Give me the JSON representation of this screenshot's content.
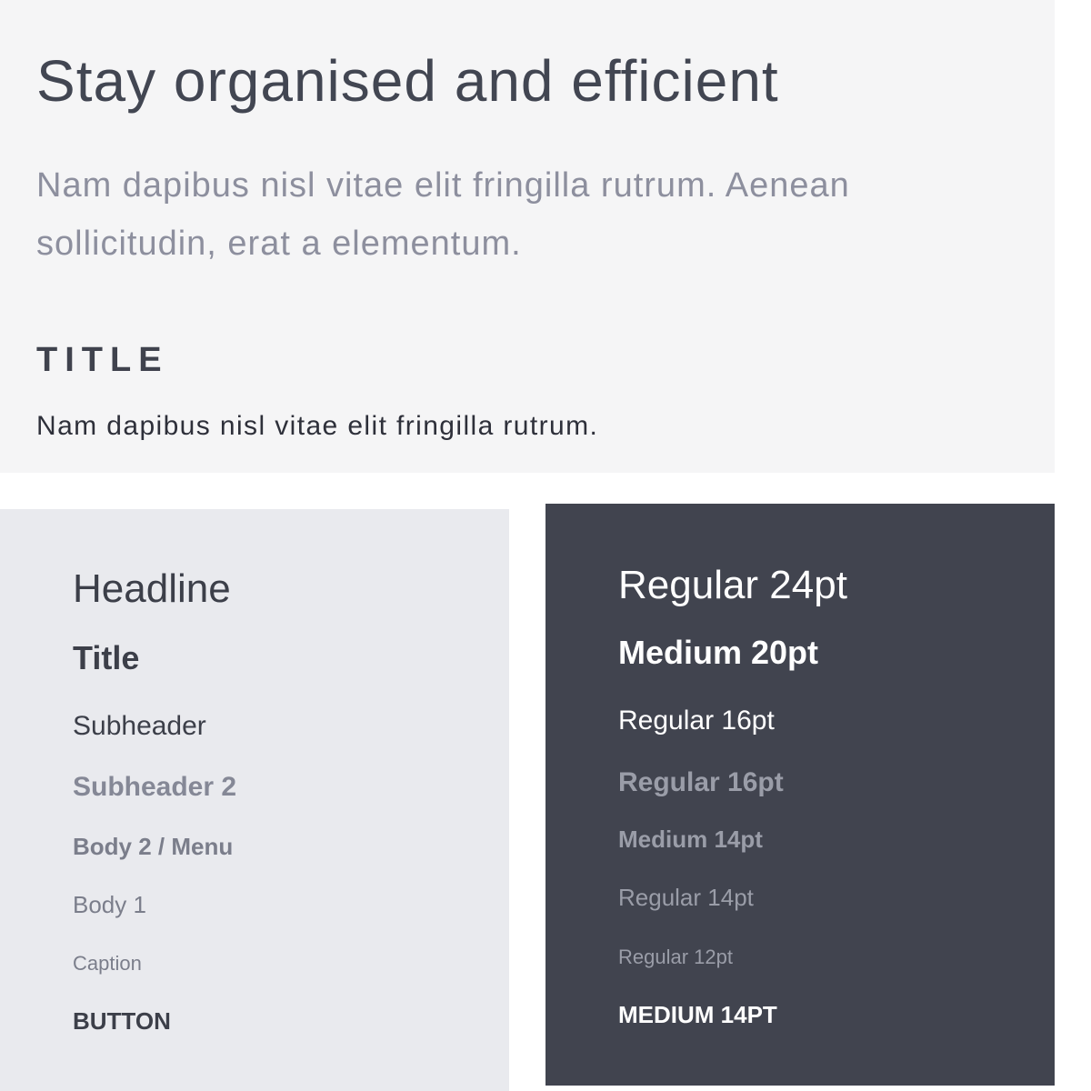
{
  "hero": {
    "title": "Stay organised and efficient",
    "subtitle": "Nam dapibus nisl vitae elit fringilla rutrum. Aenean sollicitudin, erat a elementum.",
    "label": "TITLE",
    "caption": "Nam dapibus nisl vitae elit fringilla rutrum."
  },
  "type_scale": {
    "styles": [
      "Headline",
      "Title",
      "Subheader",
      "Subheader 2",
      "Body 2 / Menu",
      "Body 1",
      "Caption",
      "BUTTON"
    ]
  },
  "type_specs": {
    "specs": [
      "Regular 24pt",
      "Medium 20pt",
      "Regular 16pt",
      "Regular 16pt",
      "Medium 14pt",
      "Regular 14pt",
      "Regular 12pt",
      "MEDIUM 14PT"
    ]
  },
  "colors": {
    "hero_background": "#f5f5f6",
    "light_panel_background": "#e9eaee",
    "dark_panel_background": "#41444f",
    "heading_text": "#424652",
    "muted_text": "#8d8f9e"
  }
}
